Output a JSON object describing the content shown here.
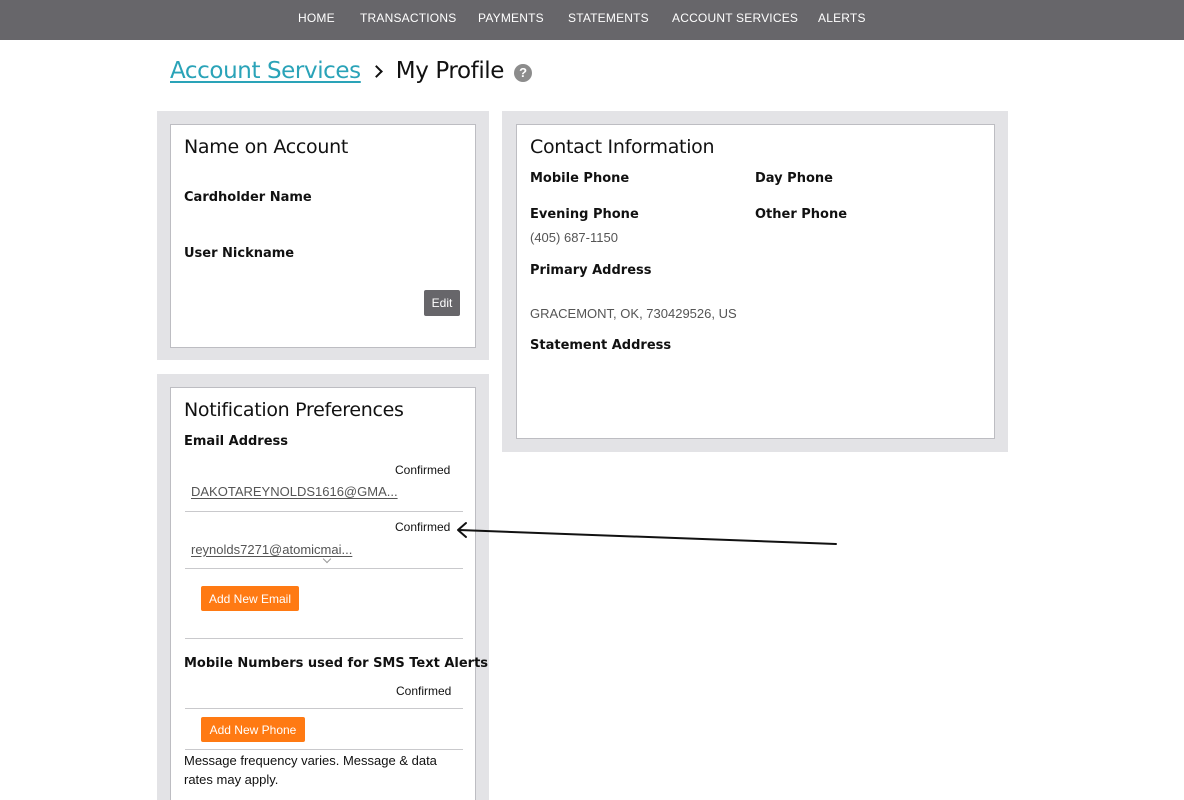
{
  "nav": {
    "items": [
      "HOME",
      "TRANSACTIONS",
      "PAYMENTS",
      "STATEMENTS",
      "ACCOUNT SERVICES",
      "ALERTS"
    ]
  },
  "breadcrumb": {
    "parent": "Account Services",
    "current": "My Profile",
    "help_glyph": "?"
  },
  "name_panel": {
    "title": "Name on Account",
    "cardholder_label": "Cardholder Name",
    "nickname_label": "User Nickname",
    "edit_button": "Edit"
  },
  "contact_panel": {
    "title": "Contact Information",
    "mobile_label": "Mobile Phone",
    "day_label": "Day Phone",
    "evening_label": "Evening Phone",
    "evening_value": "(405) 687-1150",
    "other_label": "Other Phone",
    "primary_address_label": "Primary Address",
    "primary_address_value": "GRACEMONT, OK, 730429526, US",
    "statement_address_label": "Statement Address"
  },
  "notifications": {
    "title": "Notification Preferences",
    "email_label": "Email Address",
    "emails": [
      {
        "status": "Confirmed",
        "address": "DAKOTAREYNOLDS1616@GMA..."
      },
      {
        "status": "Confirmed",
        "address": "reynolds7271@atomicmai..."
      }
    ],
    "add_email_button": "Add New Email",
    "sms_label": "Mobile Numbers used for SMS Text Alerts",
    "sms_status": "Confirmed",
    "add_phone_button": "Add New Phone",
    "disclaimer": "Message frequency varies. Message & data rates may apply."
  },
  "colors": {
    "nav_bg": "#67666a",
    "link": "#2aa3b8",
    "accent_button": "#ff7a13",
    "panel_bg": "#e3e3e6"
  },
  "icons": [
    "chevron-right-icon",
    "help-icon",
    "chevron-down-icon",
    "arrow-annotation-icon"
  ]
}
